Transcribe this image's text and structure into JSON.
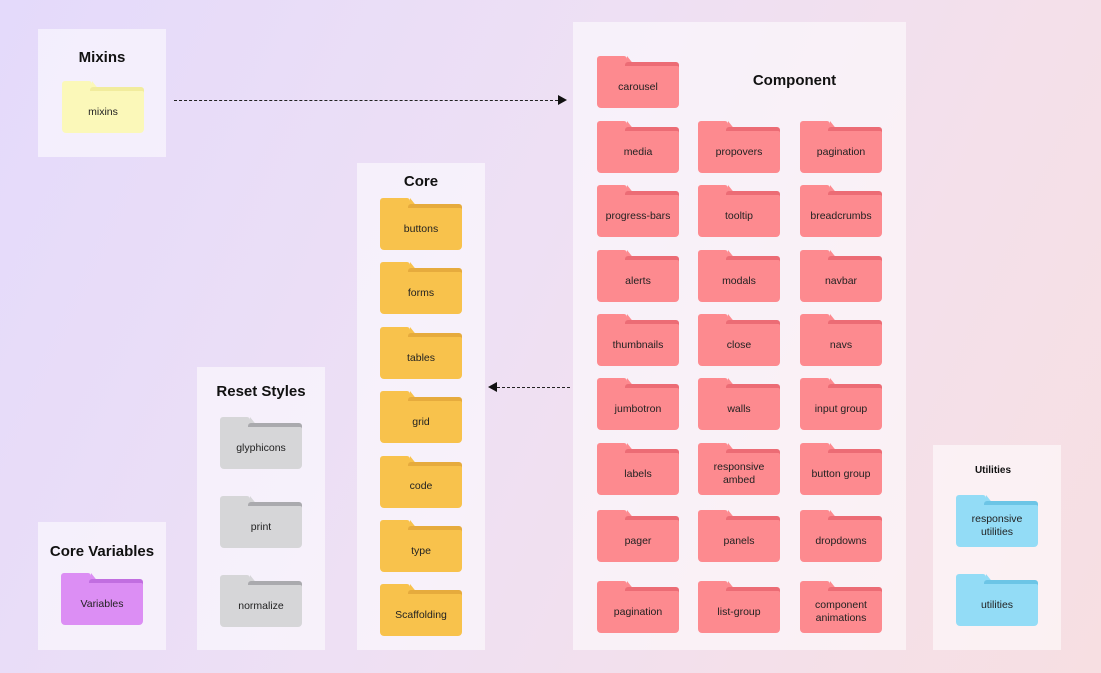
{
  "diagram": {
    "colors": {
      "component": "#fd8a8f",
      "core": "#f8c24c",
      "reset": "#d6d6d8",
      "mixins": "#fbf8b9",
      "variables": "#dc8ef4",
      "utilities": "#93dcf6"
    },
    "mixins": {
      "title": "Mixins",
      "folders": [
        "mixins"
      ]
    },
    "core_variables": {
      "title": "Core Variables",
      "folders": [
        "Variables"
      ]
    },
    "reset_styles": {
      "title": "Reset Styles",
      "folders": [
        "glyphicons",
        "print",
        "normalize"
      ]
    },
    "core": {
      "title": "Core",
      "folders": [
        "buttons",
        "forms",
        "tables",
        "grid",
        "code",
        "type",
        "Scaffolding"
      ]
    },
    "component": {
      "title": "Component",
      "folders": [
        "carousel",
        "media",
        "propovers",
        "pagination",
        "progress-bars",
        "tooltip",
        "breadcrumbs",
        "alerts",
        "modals",
        "navbar",
        "thumbnails",
        "close",
        "navs",
        "jumbotron",
        "walls",
        "input group",
        "labels",
        "responsive ambed",
        "button group",
        "pager",
        "panels",
        "dropdowns",
        "pagination",
        "list-group",
        "component animations"
      ]
    },
    "utilities": {
      "title": "Utilities",
      "folders": [
        "responsive utilities",
        "utilities"
      ]
    },
    "arrows": [
      {
        "from": "mixins",
        "to": "component"
      },
      {
        "from": "component",
        "to": "core"
      }
    ]
  }
}
